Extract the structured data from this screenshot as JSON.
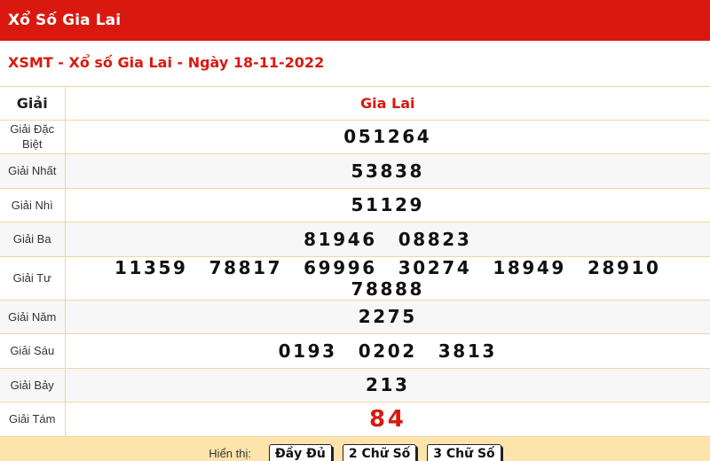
{
  "header": {
    "title": "Xổ Số Gia Lai"
  },
  "subtitle": "XSMT - Xổ số Gia Lai - Ngày 18-11-2022",
  "table": {
    "col_label": "Giải",
    "col_province": "Gia Lai",
    "rows": [
      {
        "label": "Giải Đặc Biệt",
        "numbers": [
          "051264"
        ]
      },
      {
        "label": "Giải Nhất",
        "numbers": [
          "53838"
        ]
      },
      {
        "label": "Giải Nhì",
        "numbers": [
          "51129"
        ]
      },
      {
        "label": "Giải Ba",
        "numbers": [
          "81946",
          "08823"
        ]
      },
      {
        "label": "Giải Tư",
        "numbers": [
          "11359",
          "78817",
          "69996",
          "30274",
          "18949",
          "28910",
          "78888"
        ]
      },
      {
        "label": "Giải Năm",
        "numbers": [
          "2275"
        ]
      },
      {
        "label": "Giải Sáu",
        "numbers": [
          "0193",
          "0202",
          "3813"
        ]
      },
      {
        "label": "Giải Bảy",
        "numbers": [
          "213"
        ]
      },
      {
        "label": "Giải Tám",
        "numbers": [
          "84"
        ],
        "highlight": true
      }
    ]
  },
  "footer": {
    "label": "Hiển thị:",
    "buttons": [
      "Đầy Đủ",
      "2 Chữ Số",
      "3 Chữ Số"
    ]
  },
  "colors": {
    "brand": "#d9190f",
    "footer_bg": "#fde4ac",
    "border": "#f0d7a0"
  }
}
